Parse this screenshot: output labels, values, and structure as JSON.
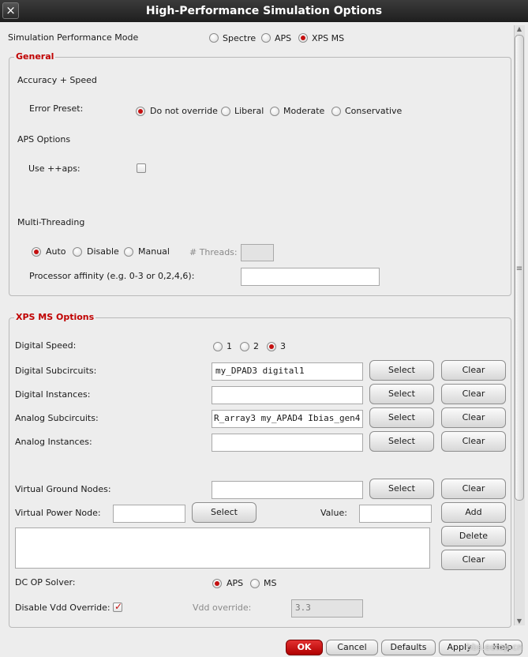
{
  "window": {
    "title": "High-Performance Simulation Options",
    "close_glyph": "×"
  },
  "perf_mode": {
    "label": "Simulation Performance Mode",
    "options": [
      "Spectre",
      "APS",
      "XPS MS"
    ],
    "selected": "XPS MS"
  },
  "general": {
    "title": "General",
    "accuracy_heading": "Accuracy + Speed",
    "error_preset_label": "Error Preset:",
    "error_options": [
      "Do not override",
      "Liberal",
      "Moderate",
      "Conservative"
    ],
    "error_selected": "Do not override",
    "aps_heading": "APS Options",
    "use_aps_label": "Use ++aps:",
    "use_aps_checked": false,
    "mt_heading": "Multi-Threading",
    "mt_options": [
      "Auto",
      "Disable",
      "Manual"
    ],
    "mt_selected": "Auto",
    "threads_label": "# Threads:",
    "threads_value": "",
    "affinity_label": "Processor affinity (e.g. 0-3 or 0,2,4,6):",
    "affinity_value": ""
  },
  "xps": {
    "title": "XPS MS Options",
    "digital_speed_label": "Digital Speed:",
    "speed_options": [
      "1",
      "2",
      "3"
    ],
    "speed_selected": "3",
    "digital_subckts_label": "Digital Subcircuits:",
    "digital_subckts_value": "my_DPAD3 digital1",
    "digital_inst_label": "Digital Instances:",
    "digital_inst_value": "",
    "analog_subckts_label": "Analog Subcircuits:",
    "analog_subckts_value": "R_array3 my_APAD4 Ibias_gen4",
    "analog_inst_label": "Analog Instances:",
    "analog_inst_value": "",
    "vgnd_label": "Virtual Ground Nodes:",
    "vgnd_value": "",
    "vpwr_label": "Virtual Power Node:",
    "vpwr_value": "",
    "value_label": "Value:",
    "value_value": "",
    "select_label": "Select",
    "clear_label": "Clear",
    "add_label": "Add",
    "delete_label": "Delete",
    "dcop_label": "DC OP Solver:",
    "dcop_options": [
      "APS",
      "MS"
    ],
    "dcop_selected": "APS",
    "vdd_override_label": "Disable Vdd Override:",
    "vdd_override_checked": true,
    "vdd_label": "Vdd override:",
    "vdd_value": "3.3"
  },
  "footer": {
    "ok": "OK",
    "cancel": "Cancel",
    "defaults": "Defaults",
    "apply": "Apply",
    "help": "Help",
    "watermark": "bbs.eetop.cn"
  },
  "colors": {
    "accent": "#c41010",
    "group_title": "#c00000"
  }
}
